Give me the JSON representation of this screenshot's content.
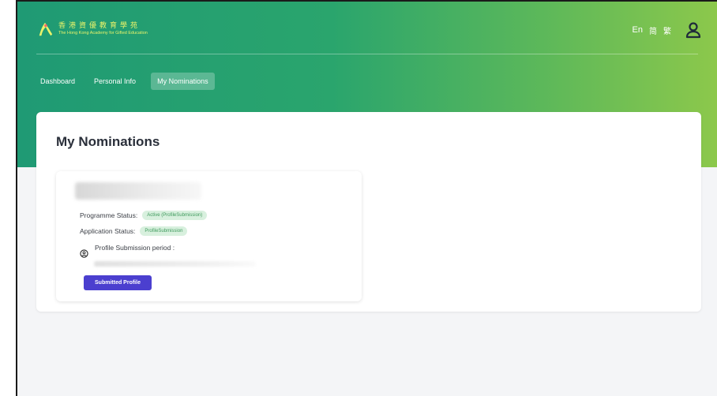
{
  "header": {
    "logo_zh": "香港資優教育學苑",
    "logo_en": "The Hong Kong Academy for Gifted Education",
    "lang_en": "En",
    "lang_sc": "简",
    "lang_tc": "繁"
  },
  "nav": {
    "tabs": [
      {
        "label": "Dashboard",
        "active": false
      },
      {
        "label": "Personal Info",
        "active": false
      },
      {
        "label": "My Nominations",
        "active": true
      }
    ]
  },
  "main": {
    "page_title": "My Nominations",
    "nomination": {
      "programme_status_label": "Programme Status:",
      "programme_status_value": "Active (ProfileSubmission)",
      "application_status_label": "Application Status:",
      "application_status_value": "ProfileSubmission",
      "period_label": "Profile Submission period :",
      "submit_button_label": "Submitted Profile"
    }
  },
  "colors": {
    "header_gradient_start": "#1f9a74",
    "header_gradient_end": "#8cc84b",
    "badge_bg": "#d8f0de",
    "badge_text": "#3e9a5c",
    "button_bg": "#4b3fcf"
  },
  "icons": {
    "logo": "academy-logo-icon",
    "user": "user-profile-icon",
    "period": "person-circle-icon"
  }
}
